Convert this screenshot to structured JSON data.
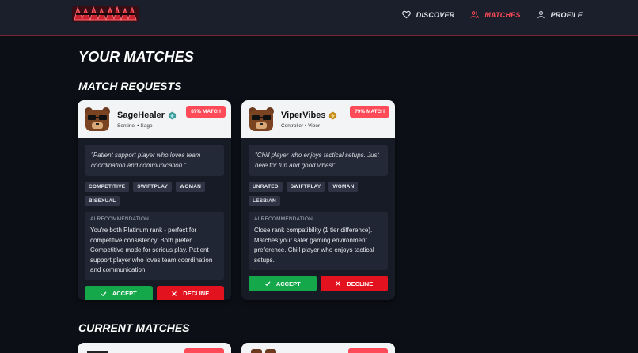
{
  "nav": {
    "items": [
      {
        "label": "DISCOVER",
        "icon": "heart-icon",
        "active": false
      },
      {
        "label": "MATCHES",
        "icon": "users-icon",
        "active": true
      },
      {
        "label": "PROFILE",
        "icon": "user-icon",
        "active": false
      }
    ]
  },
  "page": {
    "title": "YOUR MATCHES",
    "requests_heading": "MATCH REQUESTS",
    "current_heading": "CURRENT MATCHES"
  },
  "requests": [
    {
      "name": "SageHealer",
      "rank_icon": "platinum-rank-icon",
      "role": "Sentinel • Sage",
      "match": "87% MATCH",
      "bio": "\"Patient support player who loves team coordination and communication.\"",
      "tags": [
        "COMPETITIVE",
        "SWIFTPLAY",
        "WOMAN",
        "BISEXUAL"
      ],
      "rec_title": "AI RECOMMENDATION",
      "rec_text": "You're both Platinum rank - perfect for competitive consistency. Both prefer Competitive mode for serious play. Patient support player who loves team coordination and communication.",
      "accept": "ACCEPT",
      "decline": "DECLINE"
    },
    {
      "name": "ViperVibes",
      "rank_icon": "gold-rank-icon",
      "role": "Controller • Viper",
      "match": "79% MATCH",
      "bio": "\"Chill player who enjoys tactical setups. Just here for fun and good vibes!\"",
      "tags": [
        "UNRATED",
        "SWIFTPLAY",
        "WOMAN",
        "LESBIAN"
      ],
      "rec_title": "AI RECOMMENDATION",
      "rec_text": "Close rank compatibility (1 tier difference). Matches your safer gaming environment preference. Chill player who enjoys tactical setups.",
      "accept": "ACCEPT",
      "decline": "DECLINE"
    }
  ],
  "colors": {
    "accent": "#ff4a57",
    "accept": "#14a84a",
    "decline": "#e2121e",
    "background": "#0c0f16"
  }
}
